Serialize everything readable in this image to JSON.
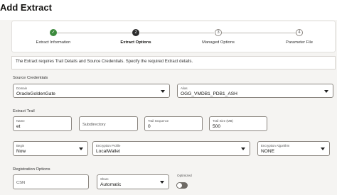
{
  "page": {
    "title": "Add Extract"
  },
  "wizard": {
    "steps": [
      {
        "label": "Extract Information",
        "state": "done",
        "number": "1",
        "icon": "check-icon"
      },
      {
        "label": "Extract Options",
        "state": "current",
        "number": "2"
      },
      {
        "label": "Managed Options",
        "state": "todo",
        "number": "3"
      },
      {
        "label": "Parameter File",
        "state": "todo",
        "number": "4"
      }
    ]
  },
  "info_message": "The Extract requires Trail Details and Source Credentials. Specify the required Extract details.",
  "source_credentials": {
    "heading": "Source Credentials",
    "domain": {
      "label": "Domain",
      "value": "OracleGoldenGate"
    },
    "alias": {
      "label": "Alias",
      "value": "OGG_VMDB1_PDB1_ASH"
    }
  },
  "extract_trail": {
    "heading": "Extract Trail",
    "name": {
      "label": "Name",
      "value": "et"
    },
    "subdirectory": {
      "placeholder": "Subdirectory"
    },
    "trail_sequence": {
      "label": "Trail Sequence",
      "value": "0"
    },
    "trail_size": {
      "label": "Trail Size (MB)",
      "value": "500"
    }
  },
  "options": {
    "begin": {
      "label": "Begin",
      "value": "Now"
    },
    "encryption_profile": {
      "label": "Encryption Profile",
      "value": "LocalWallet"
    },
    "encryption_algorithm": {
      "label": "Encryption Algorithm",
      "value": "NONE"
    }
  },
  "registration": {
    "heading": "Registration Options",
    "csn": {
      "placeholder": "CSN"
    },
    "share": {
      "label": "Share",
      "value": "Automatic"
    },
    "optimized": {
      "label": "Optimized",
      "enabled": false
    }
  },
  "colors": {
    "done": "#3c8a3d",
    "current": "#2b2b2b",
    "border": "#8b8680",
    "background": "#f5f4f2"
  }
}
